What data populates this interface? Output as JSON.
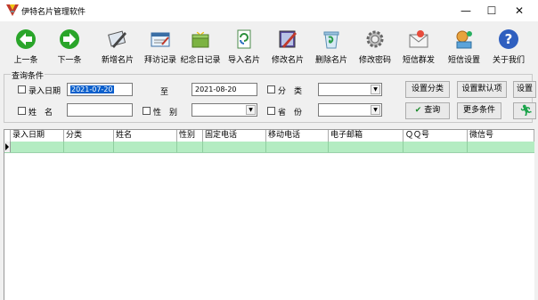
{
  "window": {
    "title": "伊特名片管理软件",
    "minimize": "—",
    "maximize": "☐",
    "close": "✕"
  },
  "toolbar": {
    "items": [
      {
        "label": "上一条",
        "icon": "arrow-up-icon"
      },
      {
        "label": "下一条",
        "icon": "arrow-down-icon"
      },
      {
        "label": "新增名片",
        "icon": "new-card-icon"
      },
      {
        "label": "拜访记录",
        "icon": "visit-record-icon"
      },
      {
        "label": "纪念日记录",
        "icon": "anniversary-icon"
      },
      {
        "label": "导入名片",
        "icon": "import-icon"
      },
      {
        "label": "修改名片",
        "icon": "edit-card-icon"
      },
      {
        "label": "删除名片",
        "icon": "delete-icon"
      },
      {
        "label": "修改密码",
        "icon": "password-icon"
      },
      {
        "label": "短信群发",
        "icon": "sms-icon"
      },
      {
        "label": "短信设置",
        "icon": "sms-settings-icon"
      },
      {
        "label": "关于我们",
        "icon": "help-icon"
      }
    ]
  },
  "query": {
    "legend": "查询条件",
    "entry_date_label": "录入日期",
    "date_from": "2021-07-20",
    "to_label": "至",
    "date_to": "2021-08-20",
    "category_label": "分　类",
    "name_label": "姓　名",
    "gender_label": "性　别",
    "province_label": "省　份",
    "name_value": "",
    "category_value": "",
    "gender_value": "",
    "province_value": "",
    "city_value": "",
    "buttons": {
      "set_category": "设置分类",
      "set_default": "设置默认项",
      "settings_cut": "设置",
      "search": "查询",
      "more": "更多条件"
    }
  },
  "grid": {
    "columns": [
      "录入日期",
      "分类",
      "姓名",
      "性别",
      "固定电话",
      "移动电话",
      "电子邮箱",
      "ＱＱ号",
      "微信号"
    ]
  },
  "colors": {
    "selected_row": "#b4ecc2",
    "selection": "#0a5fcc",
    "background": "#f0f0f0"
  }
}
